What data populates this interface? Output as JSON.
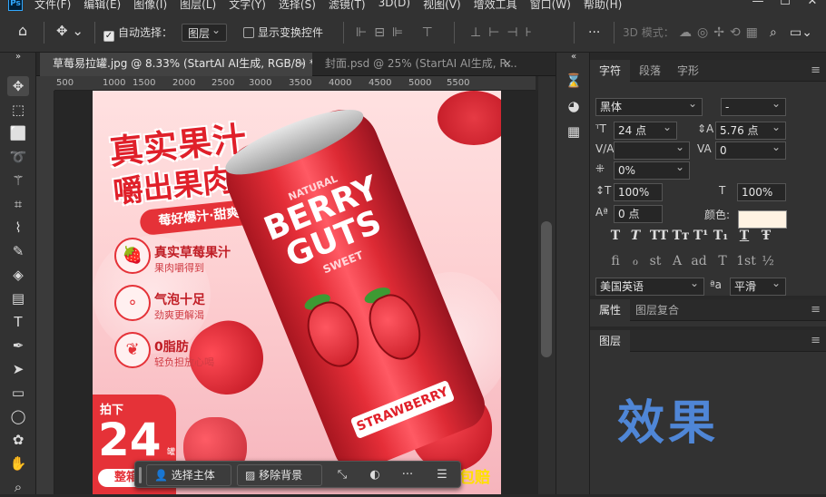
{
  "app": {
    "logo": "Ps"
  },
  "menubar": [
    "文件(F)",
    "编辑(E)",
    "图像(I)",
    "图层(L)",
    "文字(Y)",
    "选择(S)",
    "滤镜(T)",
    "3D(D)",
    "视图(V)",
    "增效工具",
    "窗口(W)",
    "帮助(H)"
  ],
  "window_controls": [
    "—",
    "☐",
    "✕"
  ],
  "options": {
    "auto_select_label": "自动选择：",
    "auto_select_checked": true,
    "auto_select_target": "图层",
    "show_transform_label": "显示变换控件",
    "show_transform_checked": false,
    "more": "···",
    "mode_3d": "3D 模式："
  },
  "tabs": [
    {
      "label": "草莓易拉罐.jpg @ 8.33% (StartAI AI生成, RGB/8) *",
      "close": "×"
    },
    {
      "label": "封面.psd @ 25% (StartAI AI生成, R...",
      "close": "×"
    }
  ],
  "ruler_ticks": [
    "500",
    "1000",
    "1500",
    "2000",
    "2500",
    "3000",
    "3500",
    "4000",
    "4500",
    "5000",
    "5500"
  ],
  "artwork": {
    "headline1": "真实果汁",
    "headline2": "嚼出果肉感!",
    "ribbon": "莓好爆汁·甜爽过瘾",
    "features": [
      {
        "title": "真实草莓果汁",
        "sub": "果肉嚼得到",
        "icon": "🍓"
      },
      {
        "title": "气泡十足",
        "sub": "劲爽更解渴",
        "icon": "∘"
      },
      {
        "title": "0脂肪",
        "sub": "轻负担放心喝",
        "icon": "❦"
      }
    ],
    "can_small": "NATURAL",
    "can_brand_1": "BERRY",
    "can_brand_2": "GUTS",
    "can_sweet": "SWEET",
    "can_label": "STRAWBERRY",
    "promo_top": "拍下",
    "promo_number": "24",
    "promo_unit": "罐",
    "promo_bottom": "整箱",
    "corner_text": "包赔"
  },
  "context_bar": {
    "select_subject": "选择主体",
    "remove_background": "移除背景",
    "more": "···"
  },
  "char_panel": {
    "tabs": [
      "字符",
      "段落",
      "字形"
    ],
    "font_family": "黑体",
    "font_style": "-",
    "font_size": "24 点",
    "leading": "5.76 点",
    "kerning": "",
    "tracking": "0",
    "tsume": "0%",
    "vertical_scale": "100%",
    "horizontal_scale": "100%",
    "baseline_shift": "0 点",
    "color_label": "颜色:",
    "text_color": "#fff3e3",
    "type_buttons": [
      "T",
      "T",
      "TT",
      "Tт",
      "T¹",
      "T₁",
      "T",
      "Ŧ"
    ],
    "ot_buttons": [
      "fi",
      "ℴ",
      "st",
      "A",
      "ad",
      "T",
      "1st",
      "½"
    ],
    "language": "美国英语",
    "aa_label": "ªa",
    "antialias": "平滑"
  },
  "props_panel": {
    "tabs": [
      "属性",
      "图层复合"
    ]
  },
  "layers_panel": {
    "tabs": [
      "图层"
    ],
    "overlay_text": "效果"
  }
}
